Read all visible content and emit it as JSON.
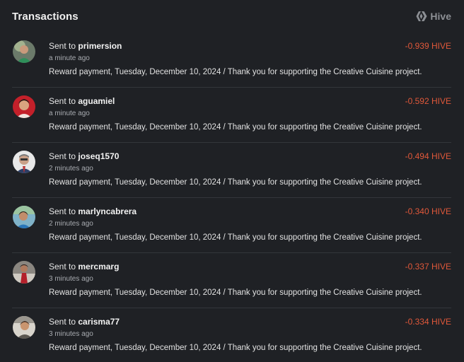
{
  "header": {
    "title": "Transactions",
    "brand": "Hive",
    "brand_icon": "hive-logo-icon"
  },
  "colors": {
    "background": "#1f2125",
    "negative_amount": "#e0583a",
    "divider": "#33363b"
  },
  "transactions": [
    {
      "prefix": "Sent to",
      "user": "primersion",
      "time": "a minute ago",
      "amount": "-0.939 HIVE",
      "memo": "Reward payment, Tuesday, December 10, 2024 / Thank you for supporting the Creative Cuisine project."
    },
    {
      "prefix": "Sent to",
      "user": "aguamiel",
      "time": "a minute ago",
      "amount": "-0.592 HIVE",
      "memo": "Reward payment, Tuesday, December 10, 2024 / Thank you for supporting the Creative Cuisine project."
    },
    {
      "prefix": "Sent to",
      "user": "joseq1570",
      "time": "2 minutes ago",
      "amount": "-0.494 HIVE",
      "memo": "Reward payment, Tuesday, December 10, 2024 / Thank you for supporting the Creative Cuisine project."
    },
    {
      "prefix": "Sent to",
      "user": "marlyncabrera",
      "time": "2 minutes ago",
      "amount": "-0.340 HIVE",
      "memo": "Reward payment, Tuesday, December 10, 2024 / Thank you for supporting the Creative Cuisine project."
    },
    {
      "prefix": "Sent to",
      "user": "mercmarg",
      "time": "3 minutes ago",
      "amount": "-0.337 HIVE",
      "memo": "Reward payment, Tuesday, December 10, 2024 / Thank you for supporting the Creative Cuisine project."
    },
    {
      "prefix": "Sent to",
      "user": "carisma77",
      "time": "3 minutes ago",
      "amount": "-0.334 HIVE",
      "memo": "Reward payment, Tuesday, December 10, 2024 / Thank you for supporting the Creative Cuisine project."
    }
  ]
}
